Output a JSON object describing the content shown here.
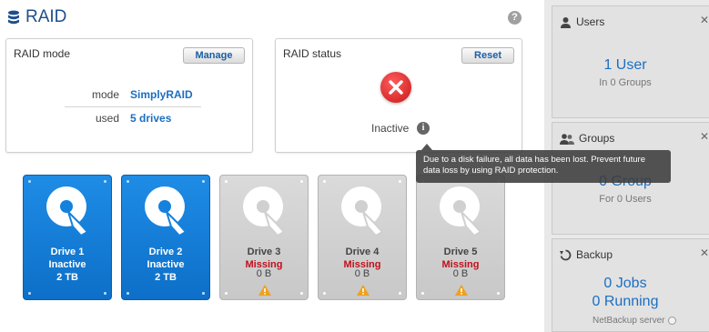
{
  "header": {
    "title": "RAID",
    "help_icon": "?"
  },
  "raid_mode": {
    "title": "RAID mode",
    "manage_label": "Manage",
    "rows": [
      {
        "key": "mode",
        "value": "SimplyRAID"
      },
      {
        "key": "used",
        "value": "5 drives"
      }
    ]
  },
  "raid_status": {
    "title": "RAID status",
    "reset_label": "Reset",
    "status_text": "Inactive",
    "info_icon": "i",
    "tooltip": "Due to a disk failure, all data has been lost. Prevent future data loss by using RAID protection."
  },
  "drives": [
    {
      "name": "Drive 1",
      "state": "Inactive",
      "size": "2 TB",
      "status": "active"
    },
    {
      "name": "Drive 2",
      "state": "Inactive",
      "size": "2 TB",
      "status": "active"
    },
    {
      "name": "Drive 3",
      "state": "Missing",
      "size": "0 B",
      "status": "missing"
    },
    {
      "name": "Drive 4",
      "state": "Missing",
      "size": "0 B",
      "status": "missing"
    },
    {
      "name": "Drive 5",
      "state": "Missing",
      "size": "0 B",
      "status": "missing"
    }
  ],
  "sidebar": {
    "users": {
      "title": "Users",
      "big": "1 User",
      "sub": "In 0 Groups",
      "close": "✕"
    },
    "groups": {
      "title": "Groups",
      "big": "0 Group",
      "sub": "For 0 Users",
      "close": "✕"
    },
    "backup": {
      "title": "Backup",
      "jobs": "0 Jobs",
      "running": "0 Running",
      "server": "NetBackup server",
      "close": "✕"
    }
  },
  "colors": {
    "accent": "#1b6fc2",
    "drive_active": "#1581dc",
    "drive_missing": "#d0d0d0",
    "missing_text": "#c0101a",
    "error_red": "#d21f1f"
  }
}
